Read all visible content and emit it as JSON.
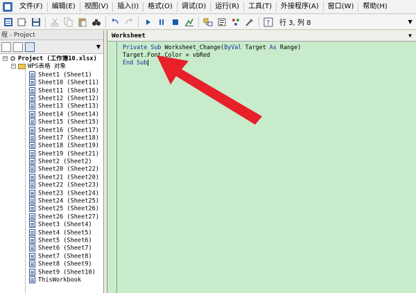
{
  "menubar": {
    "items": [
      "文件(F)",
      "编辑(E)",
      "视图(V)",
      "插入(I)",
      "格式(O)",
      "调试(D)",
      "运行(R)",
      "工具(T)",
      "外接程序(A)",
      "窗口(W)",
      "帮助(H)"
    ]
  },
  "toolbar": {
    "status": "行 3, 列 8"
  },
  "project": {
    "title": "程 - Project",
    "root": "Project (工作簿10.xlsx)",
    "folder": "WPS表格 对象",
    "items": [
      "Sheet1 (Sheet1)",
      "Sheet10 (Sheet11)",
      "Sheet11 (Sheet16)",
      "Sheet12 (Sheet12)",
      "Sheet13 (Sheet13)",
      "Sheet14 (Sheet14)",
      "Sheet15 (Sheet15)",
      "Sheet16 (Sheet17)",
      "Sheet17 (Sheet18)",
      "Sheet18 (Sheet19)",
      "Sheet19 (Sheet21)",
      "Sheet2 (Sheet2)",
      "Sheet20 (Sheet22)",
      "Sheet21 (Sheet20)",
      "Sheet22 (Sheet23)",
      "Sheet23 (Sheet24)",
      "Sheet24 (Sheet25)",
      "Sheet25 (Sheet26)",
      "Sheet26 (Sheet27)",
      "Sheet3 (Sheet4)",
      "Sheet4 (Sheet5)",
      "Sheet5 (Sheet6)",
      "Sheet6 (Sheet7)",
      "Sheet7 (Sheet8)",
      "Sheet8 (Sheet9)",
      "Sheet9 (Sheet10)",
      "ThisWorkbook"
    ]
  },
  "code_window": {
    "object_selector": "Worksheet",
    "line1_kw1": "Private Sub",
    "line1_rest": " Worksheet_Change(",
    "line1_kw2": "ByVal",
    "line1_rest2": " Target ",
    "line1_kw3": "As",
    "line1_rest3": " Range)",
    "line2": "Target.Font.Color = vbRed",
    "line3": "End Sub"
  },
  "colors": {
    "code_background": "#c8eccb",
    "keyword": "#1c2a9c",
    "arrow": "#e8202a"
  }
}
